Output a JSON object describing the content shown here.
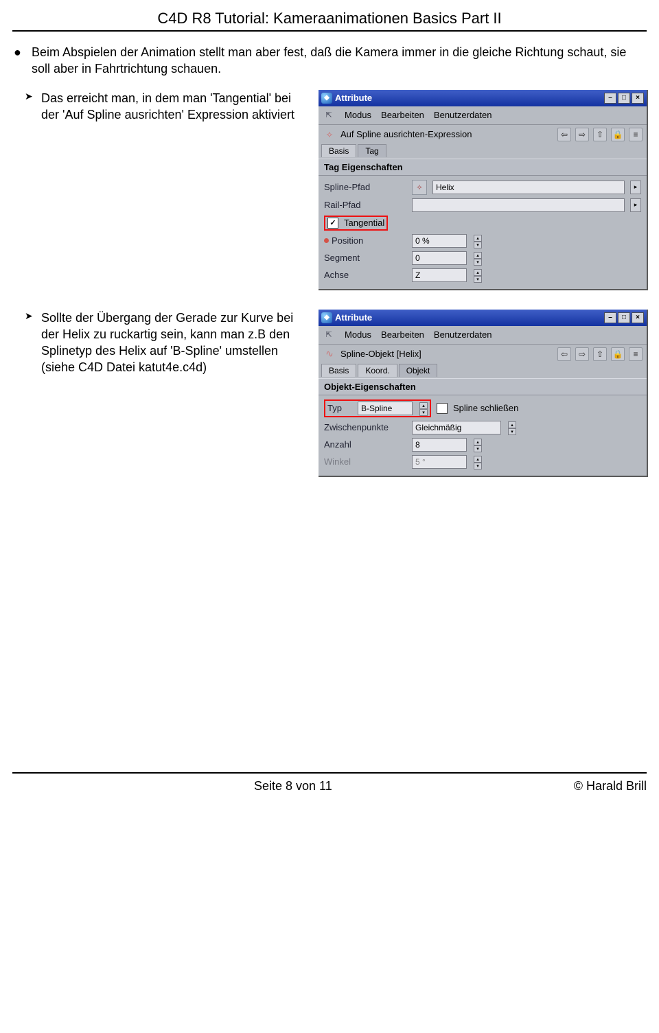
{
  "doc": {
    "title": "C4D R8 Tutorial: Kameraanimationen Basics Part II",
    "bullet1": "Beim Abspielen der Animation stellt man aber fest, daß die Kamera immer in die gleiche Richtung schaut, sie soll aber in Fahrtrichtung schauen.",
    "arrow1": "Das erreicht man, in dem man 'Tangential' bei der 'Auf Spline ausrichten' Expression aktiviert",
    "arrow2": "Sollte der Übergang der Gerade zur Kurve bei der Helix zu ruckartig sein, kann man z.B den Splinetyp des Helix auf 'B-Spline' umstellen\n(siehe C4D Datei katut4e.c4d)"
  },
  "panel1": {
    "title": "Attribute",
    "menu": {
      "modus": "Modus",
      "bearbeiten": "Bearbeiten",
      "benutzerdaten": "Benutzerdaten"
    },
    "objname": "Auf Spline ausrichten-Expression",
    "tabs": {
      "basis": "Basis",
      "tag": "Tag"
    },
    "section": "Tag Eigenschaften",
    "rows": {
      "splinepfad": {
        "label": "Spline-Pfad",
        "value": "Helix"
      },
      "railpfad": {
        "label": "Rail-Pfad",
        "value": ""
      },
      "tangential": {
        "label": "Tangential",
        "checked": "✓"
      },
      "position": {
        "label": "Position",
        "value": "0 %"
      },
      "segment": {
        "label": "Segment",
        "value": "0"
      },
      "achse": {
        "label": "Achse",
        "value": "Z"
      }
    }
  },
  "panel2": {
    "title": "Attribute",
    "menu": {
      "modus": "Modus",
      "bearbeiten": "Bearbeiten",
      "benutzerdaten": "Benutzerdaten"
    },
    "objname": "Spline-Objekt [Helix]",
    "tabs": {
      "basis": "Basis",
      "koord": "Koord.",
      "objekt": "Objekt"
    },
    "section": "Objekt-Eigenschaften",
    "rows": {
      "typ": {
        "label": "Typ",
        "value": "B-Spline",
        "close": "Spline schließen"
      },
      "zwischen": {
        "label": "Zwischenpunkte",
        "value": "Gleichmäßig"
      },
      "anzahl": {
        "label": "Anzahl",
        "value": "8"
      },
      "winkel": {
        "label": "Winkel",
        "value": "5 °"
      }
    }
  },
  "footer": {
    "page": "Seite 8 von 11",
    "author": "© Harald Brill"
  }
}
